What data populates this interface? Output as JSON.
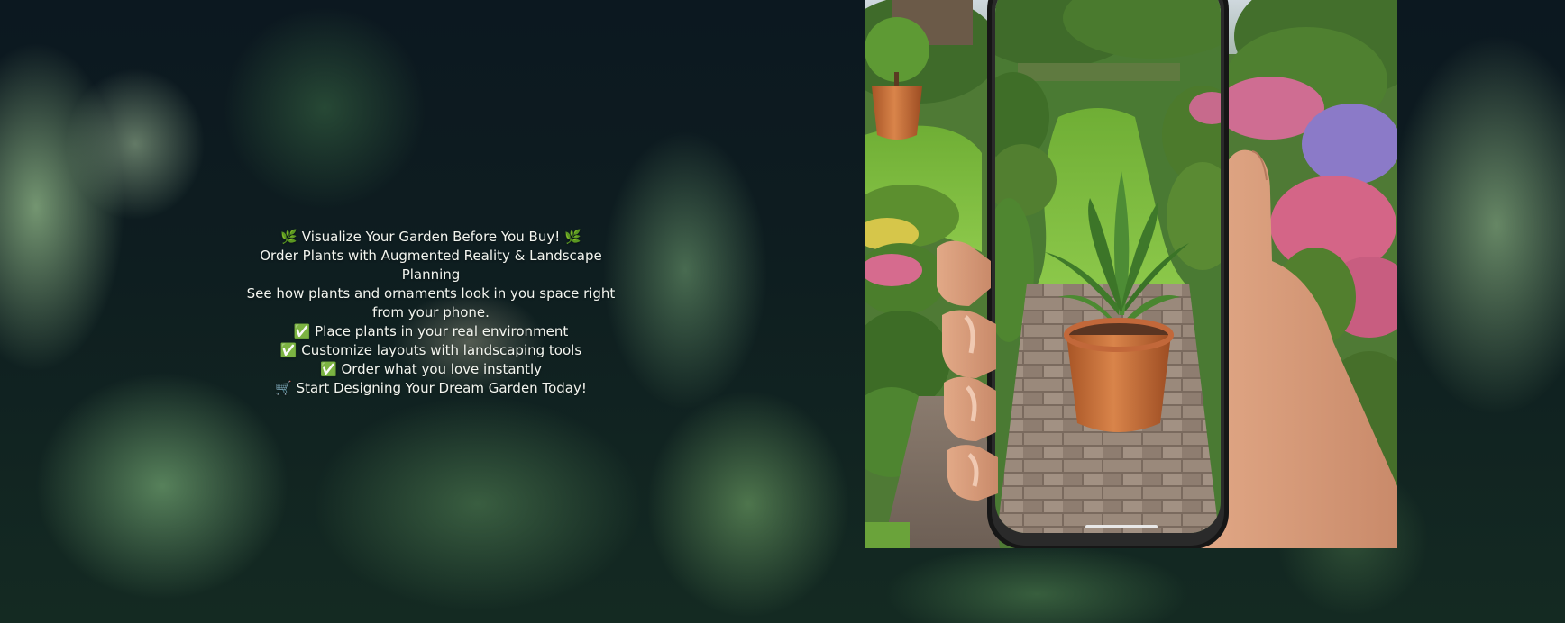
{
  "hero": {
    "headline": "🌿 Visualize Your Garden Before You Buy! 🌿",
    "subheadline": "Order Plants with Augmented Reality & Landscape Planning",
    "description": "See how plants and ornaments look in you  space right from your phone.",
    "features": [
      "✅ Place plants in your real environment",
      "✅ Customize layouts with landscaping tools",
      "✅ Order what you love instantly"
    ],
    "cta": "🛒 Start Designing Your Dream Garden Today!"
  },
  "image": {
    "icon": "garden-ar-phone-illustration"
  },
  "colors": {
    "text": "#f3f5ef",
    "background": "#0b1a1f",
    "lawn": "#7fbf3a",
    "pot": "#c9713a"
  }
}
